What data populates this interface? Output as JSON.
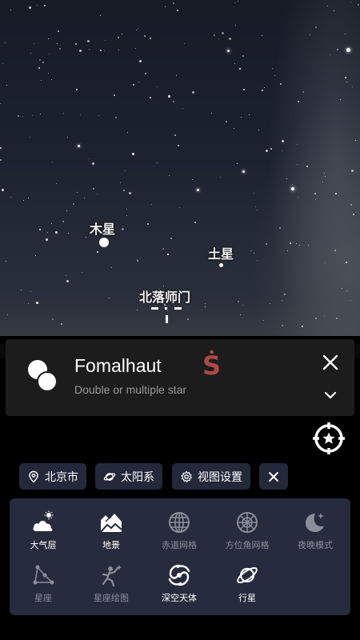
{
  "sky": {
    "labels": {
      "jupiter": "木星",
      "saturn": "土星",
      "fomalhaut_cn": "北落师门"
    }
  },
  "info_card": {
    "name": "Fomalhaut",
    "type": "Double or multiple star",
    "direction": "S",
    "icon": "double-star-icon",
    "close_icon": "close-icon",
    "expand_icon": "chevron-down-icon"
  },
  "locate_button": {
    "icon": "crosshair-star-icon"
  },
  "chips": {
    "location": "北京市",
    "solar_system": "太阳系",
    "view_settings": "视图设置"
  },
  "panel": {
    "tiles": [
      {
        "label": "大气层",
        "icon": "cloud-sun-icon",
        "active": true
      },
      {
        "label": "地景",
        "icon": "landscape-icon",
        "active": true
      },
      {
        "label": "赤道网格",
        "icon": "equatorial-grid-icon",
        "active": false
      },
      {
        "label": "方位角网格",
        "icon": "azimuthal-grid-icon",
        "active": false
      },
      {
        "label": "夜晚模式",
        "icon": "moon-star-icon",
        "active": false
      },
      {
        "label": "星座",
        "icon": "constellation-icon",
        "active": false
      },
      {
        "label": "星座绘图",
        "icon": "constellation-art-icon",
        "active": false
      },
      {
        "label": "深空天体",
        "icon": "galaxy-icon",
        "active": true
      },
      {
        "label": "行星",
        "icon": "planet-icon",
        "active": true
      }
    ]
  },
  "colors": {
    "accent_south": "#c45050",
    "panel_bg": "#262b3d",
    "chip_bg": "#23283a",
    "card_bg": "#1c1c1c",
    "inactive_text": "#8a8e9b"
  }
}
